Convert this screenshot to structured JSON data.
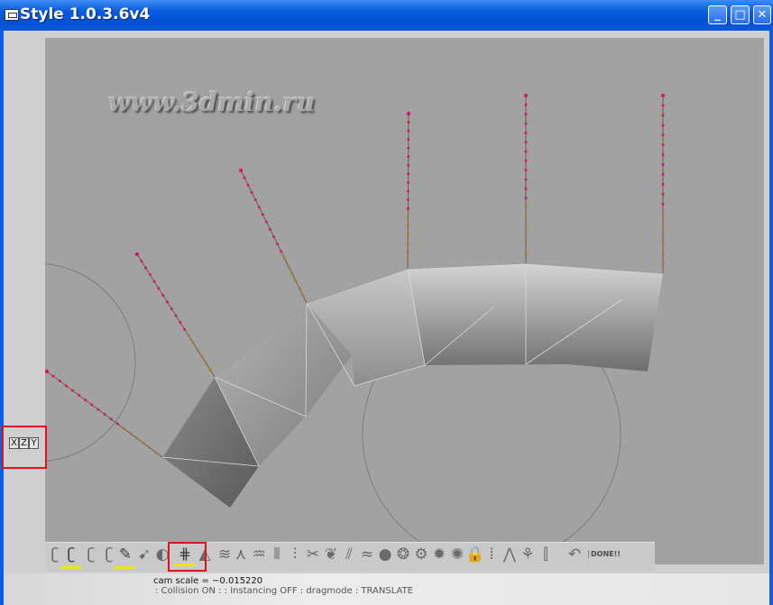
{
  "window": {
    "title": "Style 1.0.3.6v4",
    "minimize_label": "_",
    "maximize_label": "□",
    "close_label": "✕"
  },
  "viewport": {
    "watermark": "www.3dmin.ru",
    "background_color": "#a2a2a2",
    "guide_color": "#d01a6a",
    "circle_color": "#7d7d7d"
  },
  "axis_buttons": [
    "X",
    "Z",
    "Y"
  ],
  "toolbar": {
    "tools": [
      {
        "icon": "hair-curl-icon",
        "glyph": "ʗ"
      },
      {
        "icon": "hair-curl-bold-icon",
        "glyph": "ʗ",
        "selected": true
      },
      {
        "icon": "hair-curl-2-icon",
        "glyph": "ʗ"
      },
      {
        "icon": "hair-curl-3-icon",
        "glyph": "ʗ"
      },
      {
        "icon": "brush-icon",
        "glyph": "✎",
        "selected": true
      },
      {
        "icon": "arrow-select-icon",
        "glyph": "➹"
      },
      {
        "icon": "circle-tool-icon",
        "glyph": "◐"
      },
      {
        "icon": "comb-icon",
        "glyph": "⋕",
        "selected": true
      },
      {
        "icon": "triangle-sweep-icon",
        "glyph": "◭"
      },
      {
        "icon": "wave-brush-icon",
        "glyph": "≋"
      },
      {
        "icon": "lambda-icon",
        "glyph": "⋏"
      },
      {
        "icon": "fan-icon",
        "glyph": "♒"
      },
      {
        "icon": "comb-lines-icon",
        "glyph": "⦀"
      },
      {
        "icon": "stack-icon",
        "glyph": "⫶"
      },
      {
        "icon": "cut-tool-icon",
        "glyph": "✂"
      },
      {
        "icon": "leaf-icon",
        "glyph": "❦"
      },
      {
        "icon": "strands-icon",
        "glyph": "⫽"
      },
      {
        "icon": "blur-icon",
        "glyph": "≈"
      },
      {
        "icon": "sphere-icon",
        "glyph": "●"
      },
      {
        "icon": "twist-icon",
        "glyph": "❂"
      },
      {
        "icon": "gear-icon",
        "glyph": "⚙"
      },
      {
        "icon": "gear-2-icon",
        "glyph": "✹"
      },
      {
        "icon": "gear-3-icon",
        "glyph": "✺"
      },
      {
        "icon": "lock-icon",
        "glyph": "🔒"
      },
      {
        "icon": "bars-icon",
        "glyph": "⦙"
      },
      {
        "icon": "figure-icon",
        "glyph": "⋀"
      },
      {
        "icon": "wand-icon",
        "glyph": "⚘"
      },
      {
        "icon": "grass-icon",
        "glyph": "⫿"
      },
      {
        "icon": "undo-icon",
        "glyph": "↶"
      }
    ],
    "done_label": "DONE!!"
  },
  "status": {
    "cam_scale": "cam scale = −0.015220",
    "modes": ": Collision ON  : : Instancing OFF : dragmode : TRANSLATE"
  }
}
